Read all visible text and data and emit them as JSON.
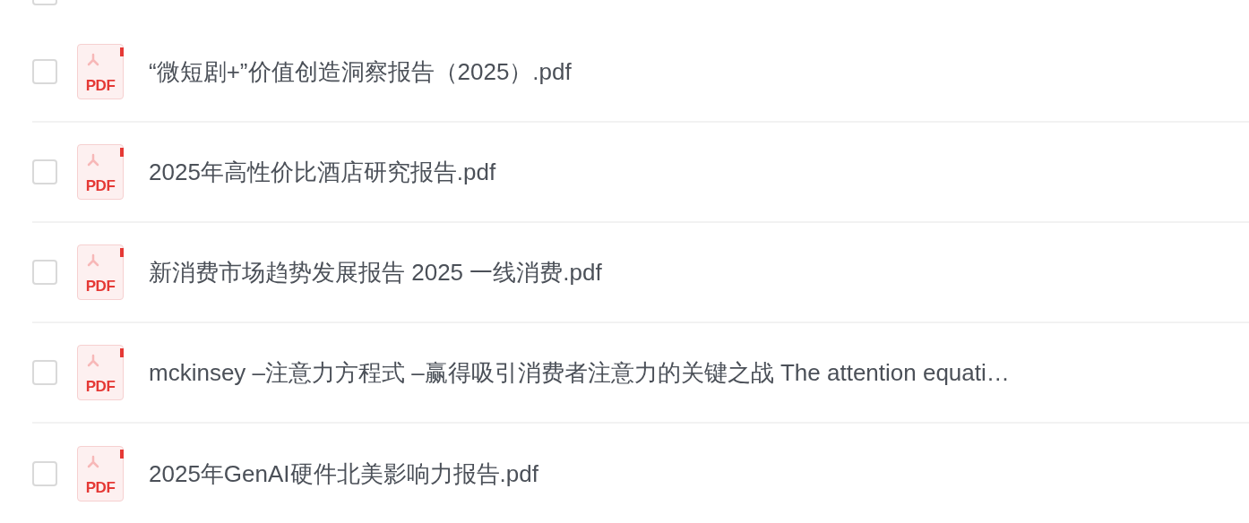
{
  "header": {
    "checked": false
  },
  "files": [
    {
      "name": "“微短剧+”价值创造洞察报告（2025）.pdf",
      "checked": false,
      "icon_label": "PDF"
    },
    {
      "name": "2025年高性价比酒店研究报告.pdf",
      "checked": false,
      "icon_label": "PDF"
    },
    {
      "name": "新消费市场趋势发展报告 2025 一线消费.pdf",
      "checked": false,
      "icon_label": "PDF"
    },
    {
      "name": "mckinsey –注意力方程式 –赢得吸引消费者注意力的关键之战 The attention equati…",
      "checked": false,
      "icon_label": "PDF"
    },
    {
      "name": "2025年GenAI硬件北美影响力报告.pdf",
      "checked": false,
      "icon_label": "PDF"
    }
  ]
}
